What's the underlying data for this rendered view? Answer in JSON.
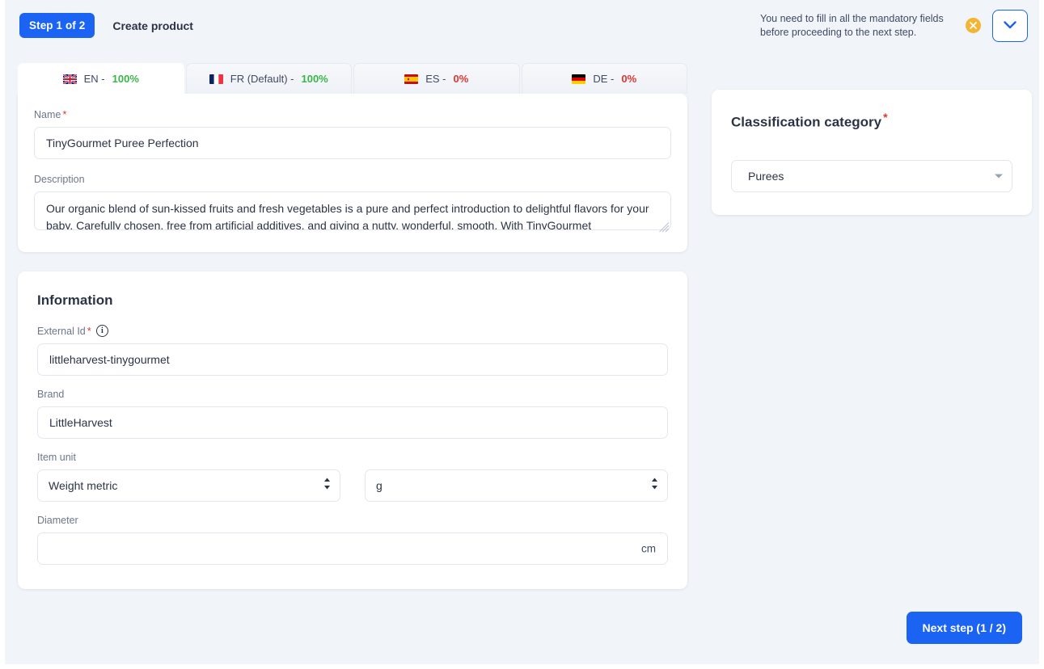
{
  "header": {
    "step_badge": "Step 1 of 2",
    "title": "Create product",
    "warning": "You need to fill in all the mandatory fields before proceeding to the next step.",
    "warning_icon": "error-circle-icon",
    "collapse_icon": "chevron-down-icon"
  },
  "tabs": [
    {
      "flag": "flag-gb",
      "label": "EN -",
      "percent": "100%",
      "state": "full",
      "active": true
    },
    {
      "flag": "flag-fr",
      "label": "FR (Default) -",
      "percent": "100%",
      "state": "full",
      "active": false
    },
    {
      "flag": "flag-es",
      "label": "ES -",
      "percent": "0%",
      "state": "zero",
      "active": false
    },
    {
      "flag": "flag-de",
      "label": "DE -",
      "percent": "0%",
      "state": "zero",
      "active": false
    }
  ],
  "translation_card": {
    "name_label": "Name",
    "name_value": "TinyGourmet Puree Perfection",
    "name_placeholder": "Name",
    "description_label": "Description",
    "description_value": "Our organic blend of sun-kissed fruits and fresh vegetables is a pure and perfect introduction to delightful flavors for your baby. Carefully chosen, free from artificial additives, and giving a nutty, wonderful, smooth. With TinyGourmet",
    "description_placeholder": "Description"
  },
  "information": {
    "section_title": "Information",
    "external_id_label": "External Id",
    "external_id_value": "littleharvest-tinygourmet",
    "external_id_placeholder": "External Id",
    "external_id_info_icon": "info-icon",
    "brand_label": "Brand",
    "brand_value": "LittleHarvest",
    "brand_placeholder": "Brand",
    "item_unit_label": "Item unit",
    "item_unit_type_value": "Weight metric",
    "item_unit_symbol_value": "g",
    "diameter_label": "Diameter",
    "diameter_value": "",
    "diameter_placeholder": "",
    "diameter_unit": "cm"
  },
  "classification": {
    "title": "Classification category",
    "category_value": "Purees",
    "caret_icon": "chevron-down-icon"
  },
  "footer": {
    "next_label": "Next step (1 / 2)"
  },
  "colors": {
    "accent": "#1b63f2",
    "warning": "#f5b431",
    "success": "#39b54a",
    "danger": "#e0352b",
    "surface": "#f1f4f9",
    "text": "#2c3345"
  }
}
